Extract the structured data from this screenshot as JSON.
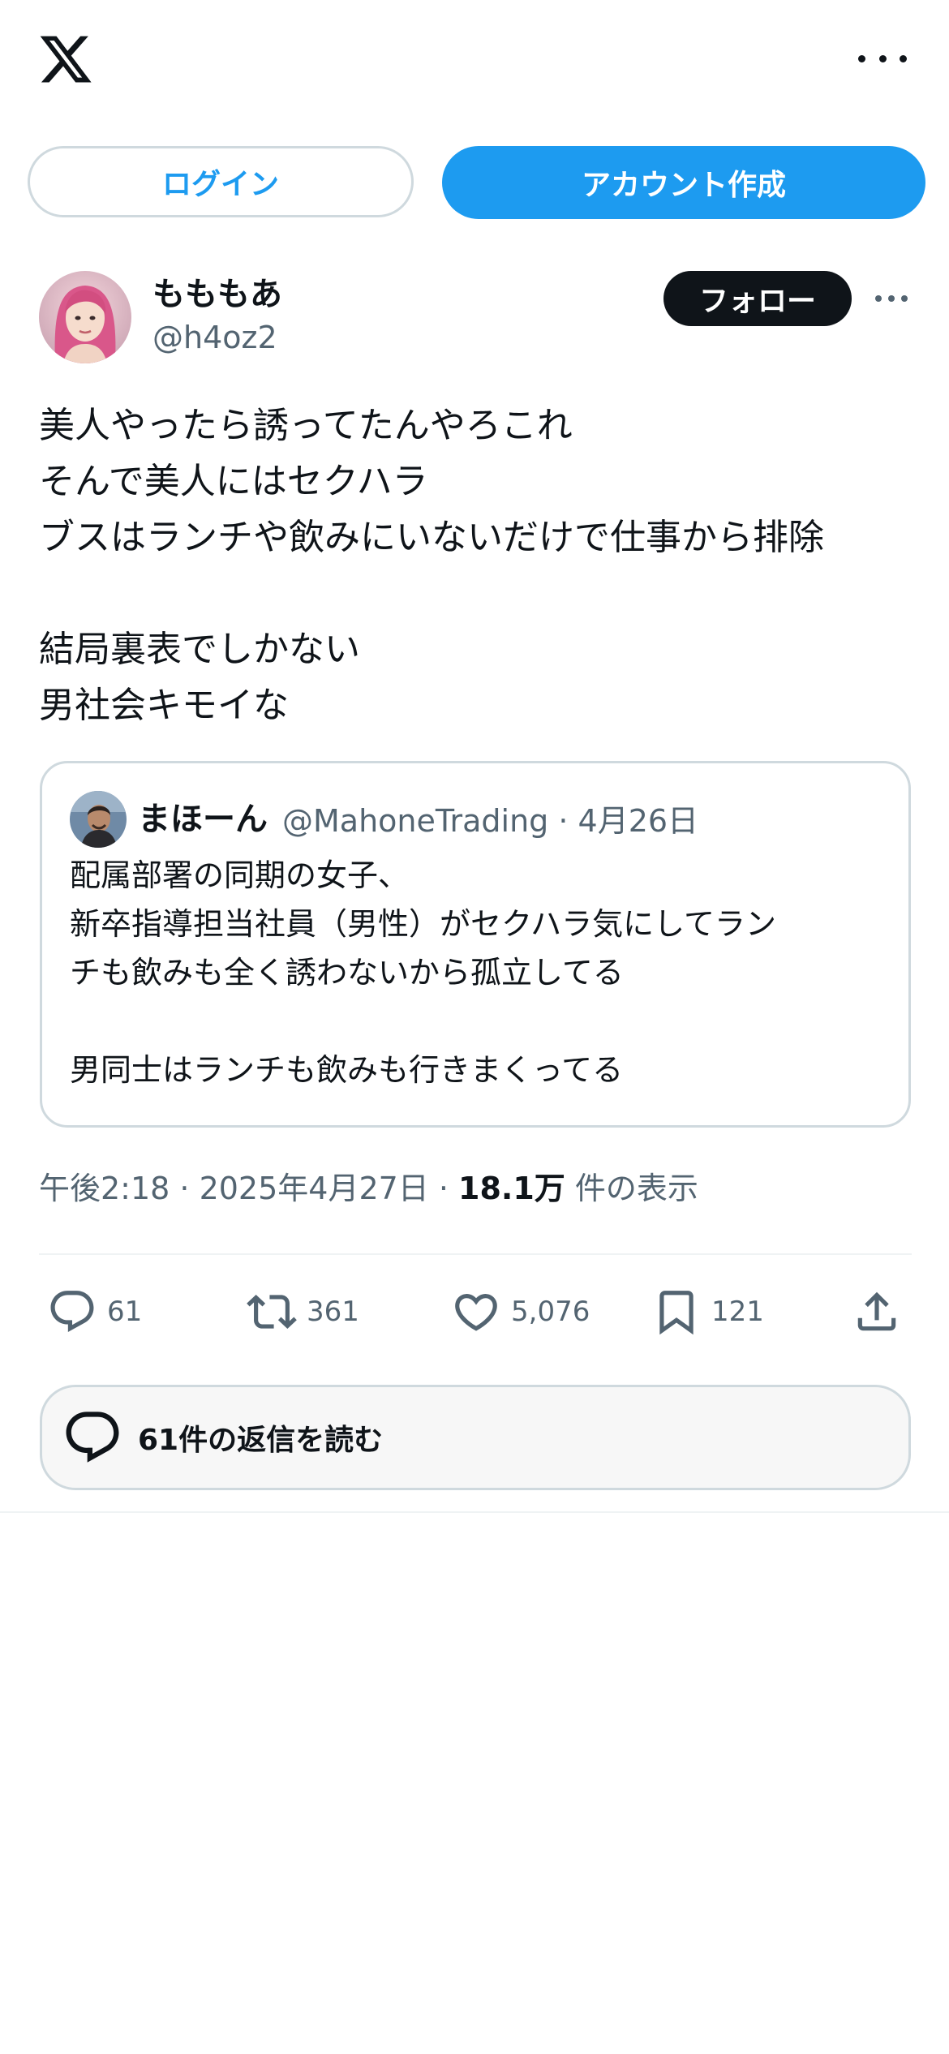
{
  "header": {
    "logo_icon": "x-logo-icon",
    "more_icon": "more-horizontal-icon"
  },
  "auth": {
    "login_label": "ログイン",
    "create_account_label": "アカウント作成"
  },
  "tweet": {
    "author_name": "もももあ",
    "author_handle": "@h4oz2",
    "follow_label": "フォロー",
    "lines": [
      "美人やったら誘ってたんやろこれ",
      "そんで美人にはセクハラ",
      "ブスはランチや飲みにいないだけで仕事から排除",
      "",
      "結局裏表でしかない",
      "男社会キモイな"
    ],
    "quote": {
      "author_name": "まほーん",
      "meta": "@MahoneTrading · 4月26日",
      "lines": [
        "配属部署の同期の女子、",
        "新卒指導担当社員（男性）がセクハラ気にしてラン",
        "チも飲みも全く誘わないから孤立してる",
        "",
        "男同士はランチも飲みも行きまくってる"
      ]
    },
    "timestamp": "午後2:18 · 2025年4月27日 · ",
    "views_count": "18.1万",
    "views_suffix": " 件の表示",
    "actions": {
      "replies": "61",
      "reposts": "361",
      "likes": "5,076",
      "bookmarks": "121"
    },
    "read_replies_label": "61件の返信を読む"
  },
  "colors": {
    "accent": "#1d9bf0",
    "text": "#0f1419",
    "secondary": "#536471",
    "border": "#cfd9de"
  }
}
